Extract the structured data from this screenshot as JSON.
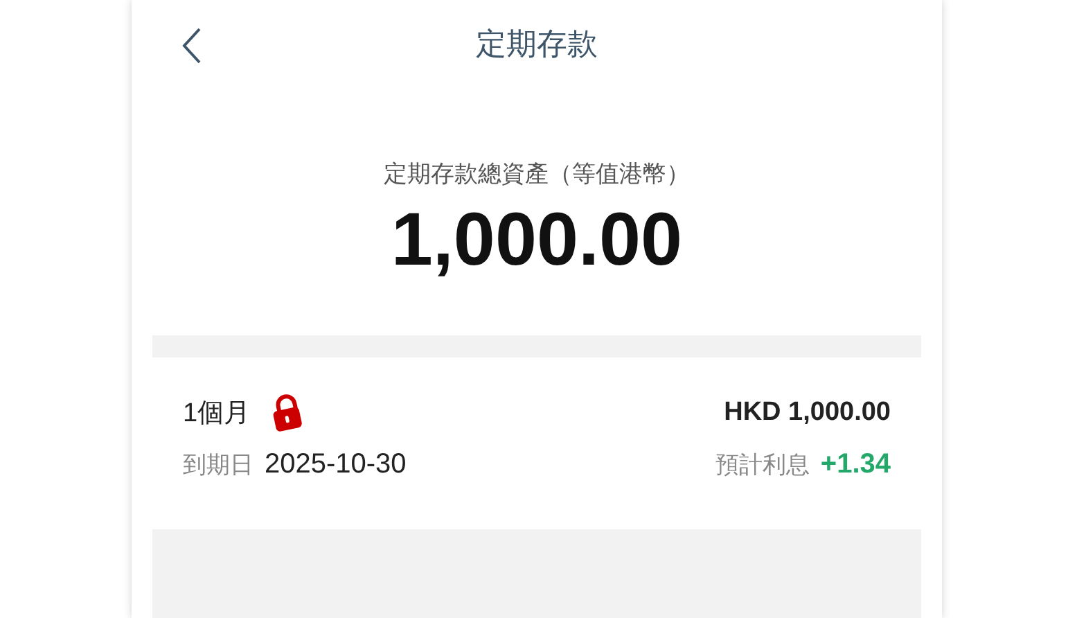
{
  "header": {
    "title": "定期存款"
  },
  "summary": {
    "label": "定期存款總資產（等值港幣）",
    "amount": "1,000.00"
  },
  "deposits": [
    {
      "term": "1個月",
      "locked": true,
      "amount": "HKD 1,000.00",
      "maturity_label": "到期日",
      "maturity_date": "2025-10-30",
      "interest_label": "預計利息",
      "interest": "+1.34"
    }
  ]
}
